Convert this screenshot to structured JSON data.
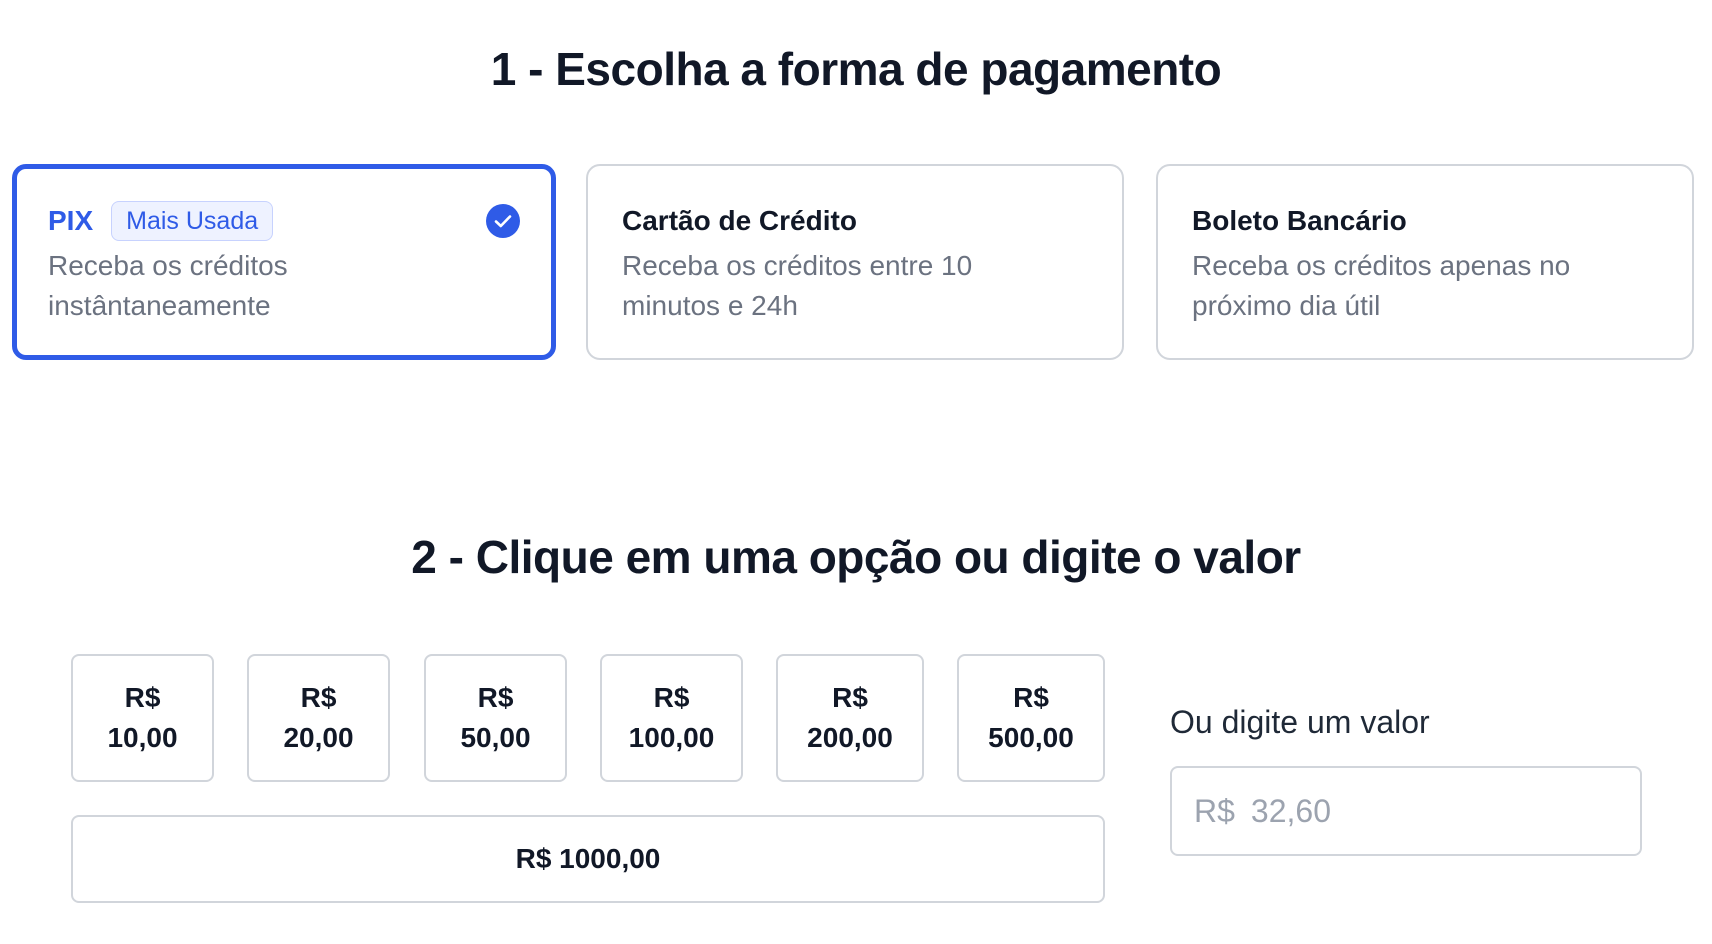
{
  "step1": {
    "title": "1 - Escolha a forma de pagamento",
    "options": [
      {
        "name": "PIX",
        "badge": "Mais Usada",
        "description": "Receba os créditos instântaneamente",
        "selected": true
      },
      {
        "name": "Cartão de Crédito",
        "description": "Receba os créditos entre 10 minutos e 24h",
        "selected": false
      },
      {
        "name": "Boleto Bancário",
        "description": "Receba os créditos apenas no próximo dia útil",
        "selected": false
      }
    ],
    "selected_icon": "check-circle-icon"
  },
  "step2": {
    "title": "2 - Clique em uma opção ou digite o valor",
    "values": [
      {
        "currency": "R$",
        "amount": "10,00"
      },
      {
        "currency": "R$",
        "amount": "20,00"
      },
      {
        "currency": "R$",
        "amount": "50,00"
      },
      {
        "currency": "R$",
        "amount": "100,00"
      },
      {
        "currency": "R$",
        "amount": "200,00"
      },
      {
        "currency": "R$",
        "amount": "500,00"
      },
      {
        "label": "R$ 1000,00"
      }
    ],
    "custom": {
      "label": "Ou digite um valor",
      "prefix": "R$",
      "placeholder": "32,60",
      "value": ""
    }
  },
  "colors": {
    "accent": "#2f5be7",
    "text": "#111827",
    "muted": "#6b7280",
    "border": "#d1d5db",
    "badge_bg": "#eef2ff"
  }
}
